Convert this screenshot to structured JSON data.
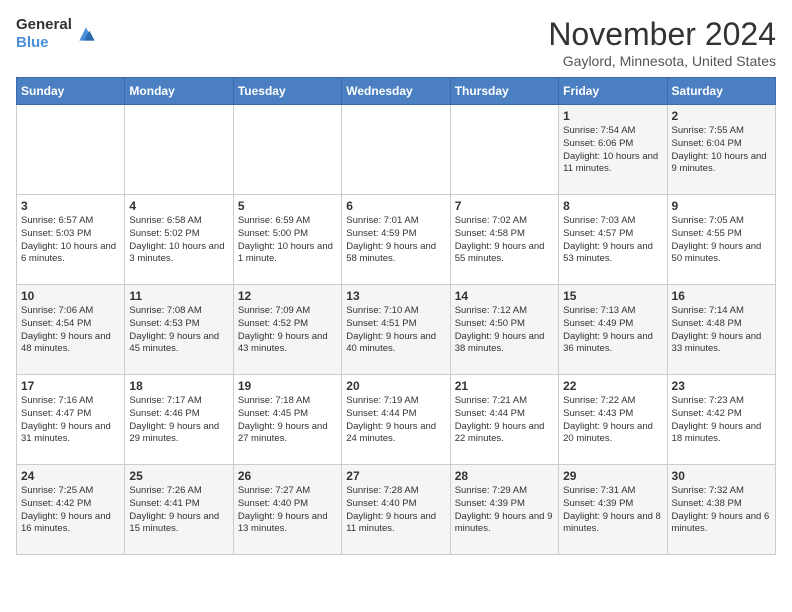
{
  "header": {
    "logo_general": "General",
    "logo_blue": "Blue",
    "title": "November 2024",
    "subtitle": "Gaylord, Minnesota, United States"
  },
  "days_of_week": [
    "Sunday",
    "Monday",
    "Tuesday",
    "Wednesday",
    "Thursday",
    "Friday",
    "Saturday"
  ],
  "weeks": [
    [
      {
        "day": "",
        "info": ""
      },
      {
        "day": "",
        "info": ""
      },
      {
        "day": "",
        "info": ""
      },
      {
        "day": "",
        "info": ""
      },
      {
        "day": "",
        "info": ""
      },
      {
        "day": "1",
        "info": "Sunrise: 7:54 AM\nSunset: 6:06 PM\nDaylight: 10 hours and 11 minutes."
      },
      {
        "day": "2",
        "info": "Sunrise: 7:55 AM\nSunset: 6:04 PM\nDaylight: 10 hours and 9 minutes."
      }
    ],
    [
      {
        "day": "3",
        "info": "Sunrise: 6:57 AM\nSunset: 5:03 PM\nDaylight: 10 hours and 6 minutes."
      },
      {
        "day": "4",
        "info": "Sunrise: 6:58 AM\nSunset: 5:02 PM\nDaylight: 10 hours and 3 minutes."
      },
      {
        "day": "5",
        "info": "Sunrise: 6:59 AM\nSunset: 5:00 PM\nDaylight: 10 hours and 1 minute."
      },
      {
        "day": "6",
        "info": "Sunrise: 7:01 AM\nSunset: 4:59 PM\nDaylight: 9 hours and 58 minutes."
      },
      {
        "day": "7",
        "info": "Sunrise: 7:02 AM\nSunset: 4:58 PM\nDaylight: 9 hours and 55 minutes."
      },
      {
        "day": "8",
        "info": "Sunrise: 7:03 AM\nSunset: 4:57 PM\nDaylight: 9 hours and 53 minutes."
      },
      {
        "day": "9",
        "info": "Sunrise: 7:05 AM\nSunset: 4:55 PM\nDaylight: 9 hours and 50 minutes."
      }
    ],
    [
      {
        "day": "10",
        "info": "Sunrise: 7:06 AM\nSunset: 4:54 PM\nDaylight: 9 hours and 48 minutes."
      },
      {
        "day": "11",
        "info": "Sunrise: 7:08 AM\nSunset: 4:53 PM\nDaylight: 9 hours and 45 minutes."
      },
      {
        "day": "12",
        "info": "Sunrise: 7:09 AM\nSunset: 4:52 PM\nDaylight: 9 hours and 43 minutes."
      },
      {
        "day": "13",
        "info": "Sunrise: 7:10 AM\nSunset: 4:51 PM\nDaylight: 9 hours and 40 minutes."
      },
      {
        "day": "14",
        "info": "Sunrise: 7:12 AM\nSunset: 4:50 PM\nDaylight: 9 hours and 38 minutes."
      },
      {
        "day": "15",
        "info": "Sunrise: 7:13 AM\nSunset: 4:49 PM\nDaylight: 9 hours and 36 minutes."
      },
      {
        "day": "16",
        "info": "Sunrise: 7:14 AM\nSunset: 4:48 PM\nDaylight: 9 hours and 33 minutes."
      }
    ],
    [
      {
        "day": "17",
        "info": "Sunrise: 7:16 AM\nSunset: 4:47 PM\nDaylight: 9 hours and 31 minutes."
      },
      {
        "day": "18",
        "info": "Sunrise: 7:17 AM\nSunset: 4:46 PM\nDaylight: 9 hours and 29 minutes."
      },
      {
        "day": "19",
        "info": "Sunrise: 7:18 AM\nSunset: 4:45 PM\nDaylight: 9 hours and 27 minutes."
      },
      {
        "day": "20",
        "info": "Sunrise: 7:19 AM\nSunset: 4:44 PM\nDaylight: 9 hours and 24 minutes."
      },
      {
        "day": "21",
        "info": "Sunrise: 7:21 AM\nSunset: 4:44 PM\nDaylight: 9 hours and 22 minutes."
      },
      {
        "day": "22",
        "info": "Sunrise: 7:22 AM\nSunset: 4:43 PM\nDaylight: 9 hours and 20 minutes."
      },
      {
        "day": "23",
        "info": "Sunrise: 7:23 AM\nSunset: 4:42 PM\nDaylight: 9 hours and 18 minutes."
      }
    ],
    [
      {
        "day": "24",
        "info": "Sunrise: 7:25 AM\nSunset: 4:42 PM\nDaylight: 9 hours and 16 minutes."
      },
      {
        "day": "25",
        "info": "Sunrise: 7:26 AM\nSunset: 4:41 PM\nDaylight: 9 hours and 15 minutes."
      },
      {
        "day": "26",
        "info": "Sunrise: 7:27 AM\nSunset: 4:40 PM\nDaylight: 9 hours and 13 minutes."
      },
      {
        "day": "27",
        "info": "Sunrise: 7:28 AM\nSunset: 4:40 PM\nDaylight: 9 hours and 11 minutes."
      },
      {
        "day": "28",
        "info": "Sunrise: 7:29 AM\nSunset: 4:39 PM\nDaylight: 9 hours and 9 minutes."
      },
      {
        "day": "29",
        "info": "Sunrise: 7:31 AM\nSunset: 4:39 PM\nDaylight: 9 hours and 8 minutes."
      },
      {
        "day": "30",
        "info": "Sunrise: 7:32 AM\nSunset: 4:38 PM\nDaylight: 9 hours and 6 minutes."
      }
    ]
  ]
}
